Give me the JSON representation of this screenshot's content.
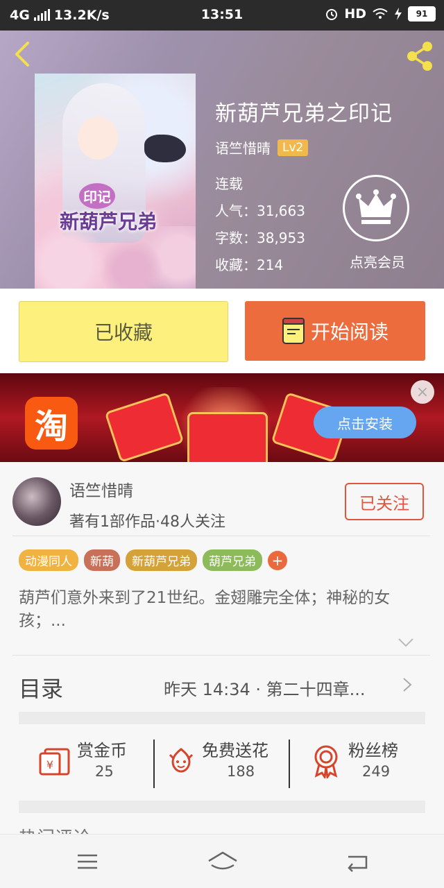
{
  "status_bar": {
    "network": "4G",
    "speed": "13.2K/s",
    "time": "13:51",
    "hd": "HD",
    "battery": "91"
  },
  "book": {
    "title": "新葫芦兄弟之印记",
    "author": "语竺惜晴",
    "level": "Lv2",
    "status": "连载",
    "popularity": "人气：31,663",
    "word_count": "字数：38,953",
    "favorites": "收藏：214",
    "member_label": "点亮会员",
    "cover_art_title": "新葫芦兄弟",
    "cover_art_small": "印记"
  },
  "actions": {
    "collected": "已收藏",
    "start_reading": "开始阅读"
  },
  "ad": {
    "app_icon_text": "淘",
    "install": "点击安装",
    "close": "×"
  },
  "author_info": {
    "name": "语竺惜晴",
    "meta": "著有1部作品·48人关注",
    "follow": "已关注"
  },
  "tags": [
    {
      "label": "动漫同人",
      "color": "#f0b342"
    },
    {
      "label": "新葫",
      "color": "#c87158"
    },
    {
      "label": "新葫芦兄弟",
      "color": "#d5a23a"
    },
    {
      "label": "葫芦兄弟",
      "color": "#8dbb5b"
    }
  ],
  "tag_add": "+",
  "synopsis": "葫芦们意外来到了21世纪。金翅雕完全体；神秘的女孩；...",
  "toc": {
    "label": "目录",
    "latest": "昨天 14:34 · 第二十四章..."
  },
  "stats": {
    "reward": {
      "label": "赏金币",
      "value": "25"
    },
    "flowers": {
      "label": "免费送花",
      "value": "188"
    },
    "fans": {
      "label": "粉丝榜",
      "value": "249"
    }
  },
  "peek_text": "热门评论",
  "colors": {
    "accent_orange": "#ed6c3e",
    "collected_yellow": "#fdf07d",
    "follow_red": "#e0553b",
    "icon_red": "#d6452b"
  }
}
